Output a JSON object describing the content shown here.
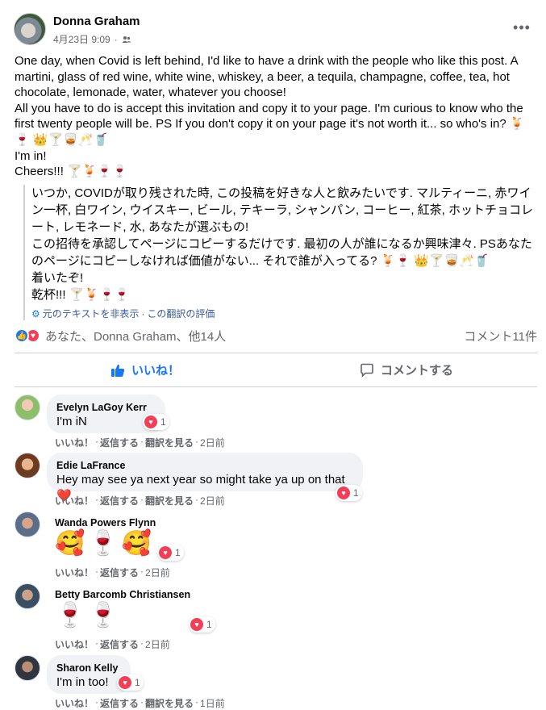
{
  "post": {
    "author": "Donna Graham",
    "date": "4月23日 9:09",
    "privacy_icon": "friends-icon",
    "body_lines": [
      "One day, when Covid is left behind, I'd like to have a drink with the people who like this post. A martini, glass of red wine, white wine, whiskey, a beer, a tequila, champagne, coffee, tea, hot chocolate, lemonade, water,  whatever you choose!",
      "All you have to do is accept this invitation and copy it to your page. I'm curious to know who the first twenty people will be. PS If you don't copy it on your page it's not worth it... so who's in? 🍹🍷 👑🍸🥃🥂🥤",
      "I'm in!",
      "Cheers!!! 🍸🍹🍷🍷"
    ]
  },
  "translation": {
    "lines": [
      "いつか, COVIDが取り残された時, この投稿を好きな人と飲みたいです. マルティーニ, 赤ワイン一杯, 白ワイン, ウイスキー, ビール, テキーラ, シャンパン, コーヒー, 紅茶, ホットチョコレート, レモネード, 水, あなたが選ぶもの!",
      "この招待を承認してページにコピーするだけです. 最初の人が誰になるか興味津々. PSあなたのページにコピーしなければ価値がない... それで誰が入ってる? 🍹🍷 👑🍸🥃🥂🥤",
      "着いたぞ!",
      "乾杯!!! 🍸🍹🍷🍷"
    ],
    "hide_original": "元のテキストを非表示",
    "rate": "この翻訳の評価"
  },
  "reactions": {
    "summary": "あなた、Donna Graham、他14人",
    "comments": "コメント11件"
  },
  "actions": {
    "like": "いいね！",
    "comment": "コメントする"
  },
  "comment_actions": {
    "like": "いいね！",
    "reply": "返信する",
    "translate": "翻訳を見る"
  },
  "comments": [
    {
      "name": "Evelyn LaGoy Kerr",
      "text": "I'm iN",
      "reaction_count": "1",
      "time": "2日前"
    },
    {
      "name": "Edie LaFrance",
      "text": "Hey may see ya next year so might take ya up on that❤️",
      "reaction_count": "1",
      "time": "2日前"
    },
    {
      "name": "Wanda Powers Flynn",
      "text": "🥰🍷🥰",
      "reaction_count": "1",
      "time": "2日前"
    },
    {
      "name": "Betty Barcomb Christiansen",
      "text": "🍷🍷",
      "reaction_count": "1",
      "time": "2日前"
    },
    {
      "name": "Sharon Kelly",
      "text": "I'm in too!",
      "reaction_count": "1",
      "time": "1日前"
    }
  ],
  "colors": {
    "accent": "#1877f2",
    "love": "#f33e58",
    "secondary_text": "#65676b",
    "bubble": "#f0f2f5"
  }
}
